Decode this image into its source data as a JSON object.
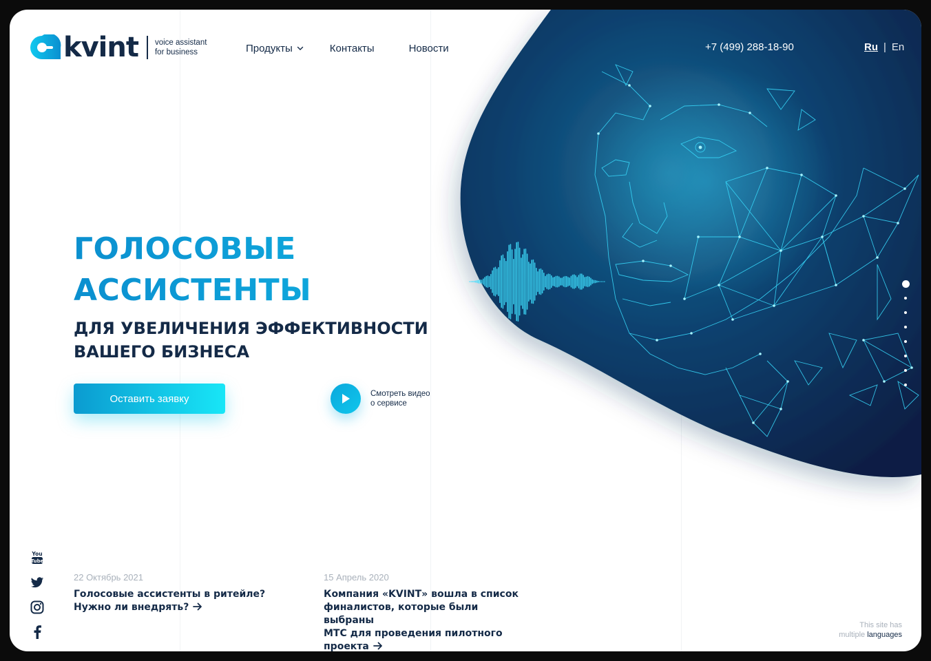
{
  "brand": {
    "name": "kvint",
    "tagline_line1": "voice assistant",
    "tagline_line2": "for business"
  },
  "nav": {
    "products": "Продукты",
    "contacts": "Контакты",
    "news": "Новости"
  },
  "header": {
    "phone": "+7 (499) 288-18-90",
    "lang_ru": "Ru",
    "lang_sep": "|",
    "lang_en": "En"
  },
  "hero": {
    "title_line1": "ГОЛОСОВЫЕ",
    "title_line2": "АССИСТЕНТЫ",
    "subtitle_line1": "ДЛЯ УВЕЛИЧЕНИЯ ЭФФЕКТИВНОСТИ",
    "subtitle_line2": "ВАШЕГО БИЗНЕСА",
    "cta_label": "Оставить заявку",
    "video_line1": "Смотреть видео",
    "video_line2": "о сервисе"
  },
  "slider": {
    "count": 8,
    "active_index": 0
  },
  "news": [
    {
      "date": "22 Октябрь 2021",
      "title_lines": [
        "Голосовые ассистенты в ритейле?",
        "Нужно ли внедрять?"
      ]
    },
    {
      "date": "15 Апрель 2020",
      "title_lines": [
        "Компания «KVINT» вошла в список",
        "финалистов, которые были выбраны",
        "МТС для проведения пилотного",
        "проекта"
      ]
    }
  ],
  "socials": [
    "youtube-icon",
    "twitter-icon",
    "instagram-icon",
    "facebook-icon"
  ],
  "footnote": {
    "line1": "This site has",
    "line2_a": "multiple",
    "line2_b": "languages"
  },
  "colors": {
    "navy": "#142a47",
    "accent": "#0aa6d8",
    "cyan": "#18e6f7",
    "blob_dark": "#08244a",
    "blob_mid": "#0d4d7a"
  }
}
